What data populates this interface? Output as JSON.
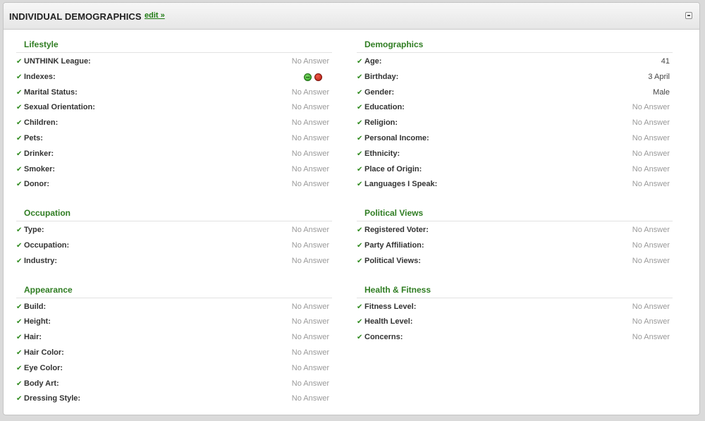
{
  "header": {
    "title": "INDIVIDUAL DEMOGRAPHICS",
    "edit_label": "edit »"
  },
  "colors": {
    "accent": "#2f7d22",
    "check": "#2f8a1e",
    "muted": "#9a9a9a"
  },
  "check_glyph": "✔",
  "left": [
    {
      "title": "Lifestyle",
      "rows": [
        {
          "label": "UNTHINK League:",
          "value": "No Answer"
        },
        {
          "label": "Indexes:",
          "value": "",
          "icons": [
            "green-minus-icon",
            "red-circle-icon"
          ]
        },
        {
          "label": "Marital Status:",
          "value": "No Answer"
        },
        {
          "label": "Sexual Orientation:",
          "value": "No Answer"
        },
        {
          "label": "Children:",
          "value": "No Answer"
        },
        {
          "label": "Pets:",
          "value": "No Answer"
        },
        {
          "label": "Drinker:",
          "value": "No Answer"
        },
        {
          "label": "Smoker:",
          "value": "No Answer"
        },
        {
          "label": "Donor:",
          "value": "No Answer"
        }
      ]
    },
    {
      "title": "Occupation",
      "rows": [
        {
          "label": "Type:",
          "value": "No Answer"
        },
        {
          "label": "Occupation:",
          "value": "No Answer"
        },
        {
          "label": "Industry:",
          "value": "No Answer"
        }
      ]
    },
    {
      "title": "Appearance",
      "rows": [
        {
          "label": "Build:",
          "value": "No Answer"
        },
        {
          "label": "Height:",
          "value": "No Answer"
        },
        {
          "label": "Hair:",
          "value": "No Answer"
        },
        {
          "label": "Hair Color:",
          "value": "No Answer"
        },
        {
          "label": "Eye Color:",
          "value": "No Answer"
        },
        {
          "label": "Body Art:",
          "value": "No Answer"
        },
        {
          "label": "Dressing Style:",
          "value": "No Answer"
        }
      ]
    }
  ],
  "right": [
    {
      "title": "Demographics",
      "rows": [
        {
          "label": "Age:",
          "value": "41",
          "set": true
        },
        {
          "label": "Birthday:",
          "value": "3 April",
          "set": true
        },
        {
          "label": "Gender:",
          "value": "Male",
          "set": true
        },
        {
          "label": "Education:",
          "value": "No Answer"
        },
        {
          "label": "Religion:",
          "value": "No Answer"
        },
        {
          "label": "Personal Income:",
          "value": "No Answer"
        },
        {
          "label": "Ethnicity:",
          "value": "No Answer"
        },
        {
          "label": "Place of Origin:",
          "value": "No Answer"
        },
        {
          "label": "Languages I Speak:",
          "value": "No Answer"
        }
      ]
    },
    {
      "title": "Political Views",
      "rows": [
        {
          "label": "Registered Voter:",
          "value": "No Answer"
        },
        {
          "label": "Party Affiliation:",
          "value": "No Answer"
        },
        {
          "label": "Political Views:",
          "value": "No Answer"
        }
      ]
    },
    {
      "title": "Health & Fitness",
      "rows": [
        {
          "label": "Fitness Level:",
          "value": "No Answer"
        },
        {
          "label": "Health Level:",
          "value": "No Answer"
        },
        {
          "label": "Concerns:",
          "value": "No Answer"
        }
      ]
    }
  ]
}
